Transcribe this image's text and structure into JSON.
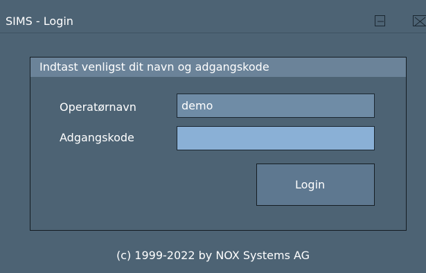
{
  "window": {
    "title": "SIMS - Login",
    "minimize_icon": "minimize-icon",
    "close_icon": "close-icon"
  },
  "login_group": {
    "header": "Indtast venligst dit navn og adgangskode",
    "username_label": "Operatørnavn",
    "username_value": "demo",
    "password_label": "Adgangskode",
    "password_value": "",
    "login_button": "Login"
  },
  "footer": {
    "copyright": "(c) 1999-2022 by NOX Systems AG"
  },
  "colors": {
    "window_bg": "#4d6374",
    "group_header_bg": "#6b8399",
    "input_bg": "#6f8ca6",
    "password_input_bg": "#8ab0d6",
    "button_bg": "#5e7890"
  }
}
